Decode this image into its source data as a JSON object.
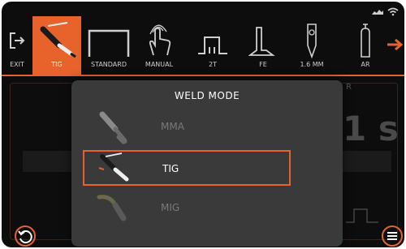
{
  "toolbar": {
    "items": [
      {
        "label": "EXIT",
        "icon": "exit-icon",
        "active": false
      },
      {
        "label": "TIG",
        "icon": "tig-torch-icon",
        "active": true
      },
      {
        "label": "STANDARD",
        "icon": "standard-wave-icon",
        "active": false
      },
      {
        "label": "MANUAL",
        "icon": "manual-hand-icon",
        "active": false
      },
      {
        "label": "2T",
        "icon": "2t-trigger-icon",
        "active": false
      },
      {
        "label": "FE",
        "icon": "fe-material-icon",
        "active": false
      },
      {
        "label": "1.6 MM",
        "icon": "electrode-icon",
        "active": false
      },
      {
        "label": "AR",
        "icon": "gas-cylinder-icon",
        "active": false
      }
    ],
    "next_icon": "arrow-right-icon"
  },
  "background": {
    "partial_value": "1 s",
    "partial_letter": "R"
  },
  "modal": {
    "title": "WELD MODE",
    "options": [
      {
        "label": "MMA",
        "icon": "mma-electrode-holder-icon",
        "selected": false
      },
      {
        "label": "TIG",
        "icon": "tig-torch-icon",
        "selected": true
      },
      {
        "label": "MIG",
        "icon": "mig-torch-icon",
        "selected": false
      }
    ]
  },
  "colors": {
    "accent": "#e8622c",
    "background": "#0d0d0d",
    "modal": "#3a3a3a",
    "dim_text": "#7a7a7a"
  }
}
